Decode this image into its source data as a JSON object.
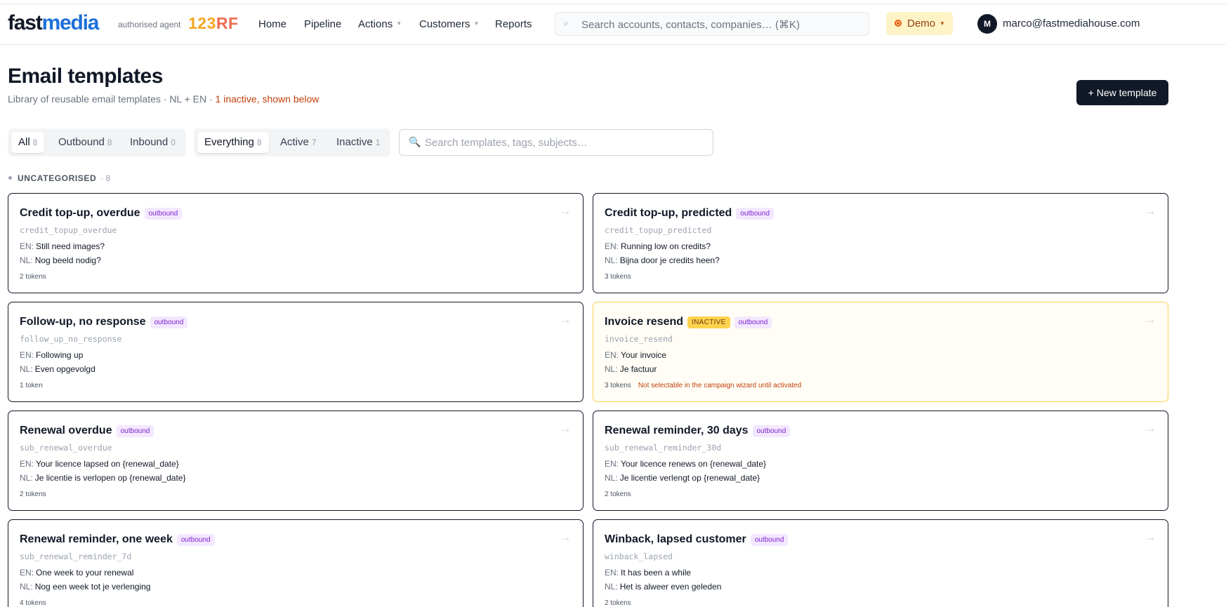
{
  "header": {
    "logo_part1": "fast",
    "logo_part2": "media",
    "agent_label": "authorised agent",
    "partner_logo_a": "123",
    "partner_logo_b": "RF",
    "nav": {
      "home": "Home",
      "pipeline": "Pipeline",
      "actions": "Actions",
      "customers": "Customers",
      "reports": "Reports"
    },
    "search_placeholder": "Search accounts, contacts, companies… (⌘K)",
    "demo_label": "Demo",
    "avatar_initial": "M",
    "user_email": "marco@fastmediahouse.com"
  },
  "page": {
    "title": "Email templates",
    "subtitle": "Library of reusable email templates · NL + EN · ",
    "subtitle_warning": "1 inactive, shown below",
    "new_button": "+ New template"
  },
  "filters": {
    "direction": [
      {
        "label": "All",
        "count": "8",
        "active": true
      },
      {
        "label": "Outbound",
        "count": "8",
        "active": false
      },
      {
        "label": "Inbound",
        "count": "0",
        "active": false
      }
    ],
    "status": [
      {
        "label": "Everything",
        "count": "8",
        "active": true
      },
      {
        "label": "Active",
        "count": "7",
        "active": false
      },
      {
        "label": "Inactive",
        "count": "1",
        "active": false
      }
    ],
    "search_placeholder": "Search templates, tags, subjects…"
  },
  "section": {
    "title": "UNCATEGORISED",
    "count": "· 8"
  },
  "labels": {
    "en": "EN:",
    "nl": "NL:",
    "arrow": "→"
  },
  "templates": [
    {
      "name": "Credit top-up, overdue",
      "badge": "outbound",
      "code": "credit_topup_overdue",
      "en": "Still need images?",
      "nl": "Nog beeld nodig?",
      "tokens": "2 tokens"
    },
    {
      "name": "Credit top-up, predicted",
      "badge": "outbound",
      "code": "credit_topup_predicted",
      "en": "Running low on credits?",
      "nl": "Bijna door je credits heen?",
      "tokens": "3 tokens"
    },
    {
      "name": "Follow-up, no response",
      "badge": "outbound",
      "code": "follow_up_no_response",
      "en": "Following up",
      "nl": "Even opgevolgd",
      "tokens": "1 token"
    },
    {
      "name": "Invoice resend",
      "status_badge": "INACTIVE",
      "badge": "outbound",
      "code": "invoice_resend",
      "en": "Your invoice",
      "nl": "Je factuur",
      "tokens": "3 tokens",
      "note": "Not selectable in the campaign wizard until activated"
    },
    {
      "name": "Renewal overdue",
      "badge": "outbound",
      "code": "sub_renewal_overdue",
      "en": "Your licence lapsed on {renewal_date}",
      "nl": "Je licentie is verlopen op {renewal_date}",
      "tokens": "2 tokens"
    },
    {
      "name": "Renewal reminder, 30 days",
      "badge": "outbound",
      "code": "sub_renewal_reminder_30d",
      "en": "Your licence renews on {renewal_date}",
      "nl": "Je licentie verlengt op {renewal_date}",
      "tokens": "2 tokens"
    },
    {
      "name": "Renewal reminder, one week",
      "badge": "outbound",
      "code": "sub_renewal_reminder_7d",
      "en": "One week to your renewal",
      "nl": "Nog een week tot je verlenging",
      "tokens": "4 tokens"
    },
    {
      "name": "Winback, lapsed customer",
      "badge": "outbound",
      "code": "winback_lapsed",
      "en": "It has been a while",
      "nl": "Het is alweer even geleden",
      "tokens": "2 tokens"
    }
  ]
}
